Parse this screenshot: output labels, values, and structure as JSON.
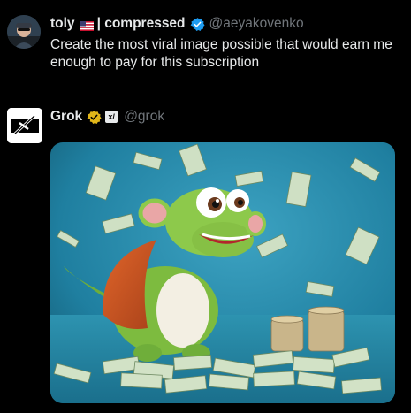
{
  "top_post": {
    "display_name": "toly",
    "name_suffix": "| compressed",
    "handle": "@aeyakovenko",
    "text": "Create the most viral image possible that would earn me enough to pay for this subscription"
  },
  "reply_post": {
    "display_name": "Grok",
    "handle": "@grok",
    "badge_text": "x/",
    "image_alt": "cartoon lizard surrounded by money"
  },
  "colors": {
    "background": "#000000",
    "text": "#e7e9ea",
    "muted": "#71767b",
    "verified_blue": "#1d9bf0",
    "gold_badge": "#e2b719"
  }
}
